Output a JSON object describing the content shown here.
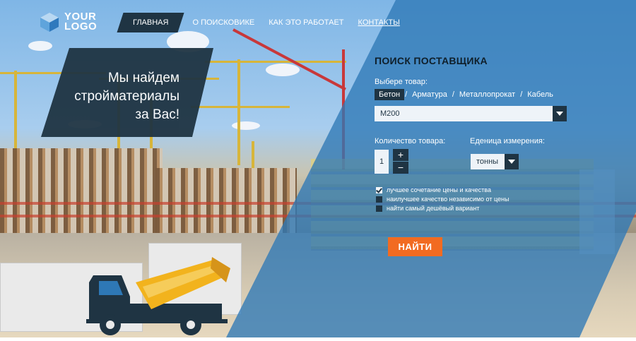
{
  "logo": {
    "line1": "YOUR",
    "line2": "LOGO"
  },
  "nav": {
    "items": [
      {
        "label": "ГЛАВНАЯ"
      },
      {
        "label": "О ПОИСКОВИКЕ"
      },
      {
        "label": "КАК ЭТО РАБОТАЕТ"
      },
      {
        "label": "КОНТАКТЫ"
      }
    ]
  },
  "hero": {
    "line1": "Мы найдем",
    "line2": "стройматериалы",
    "line3": "за Вас!"
  },
  "search": {
    "title": "ПОИСК ПОСТАВЩИКА",
    "product_label": "Выбере товар:",
    "products": [
      "Бетон",
      "Арматура",
      "Металлопрокат",
      "Кабель"
    ],
    "selected_product": "Бетон",
    "grade_value": "М200",
    "quantity_label": "Количество товара:",
    "quantity_value": "1",
    "plus": "+",
    "minus": "−",
    "unit_label": "Еденица измерения:",
    "unit_value": "тонны",
    "options": [
      {
        "label": "лучшее сочетание цены и качества",
        "checked": true
      },
      {
        "label": "наилучшее качество независимо от цены",
        "checked": false
      },
      {
        "label": "найти самый дешёвый вариант",
        "checked": false
      }
    ],
    "submit_label": "НАЙТИ"
  },
  "colors": {
    "accent": "#f26b21",
    "dark": "#1f3443",
    "overlay": "#2e78b6",
    "mixer_drum": "#f2b31d"
  }
}
